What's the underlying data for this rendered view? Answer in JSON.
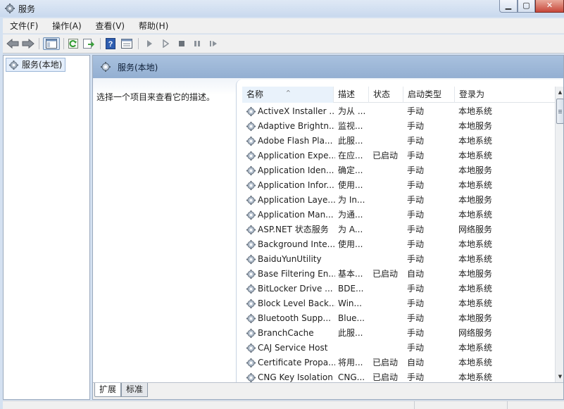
{
  "window": {
    "title": "服务",
    "app_icon": "gear-icon",
    "controls": [
      "minimize-icon",
      "maximize-icon",
      "close-icon"
    ]
  },
  "menu": [
    {
      "label": "文件(F)"
    },
    {
      "label": "操作(A)"
    },
    {
      "label": "查看(V)"
    },
    {
      "label": "帮助(H)"
    }
  ],
  "toolbar": {
    "buttons": [
      "back-arrow-icon",
      "forward-arrow-icon",
      "show-hide-tree-icon",
      "refresh-icon",
      "export-list-icon",
      "help-icon",
      "properties-icon",
      "start-service-icon",
      "start-service-params-icon",
      "stop-service-icon",
      "pause-service-icon",
      "restart-service-icon"
    ]
  },
  "tree": {
    "selected_label": "服务(本地)"
  },
  "main": {
    "header_title": "服务(本地)",
    "description_prompt": "选择一个项目来查看它的描述。",
    "columns": {
      "name": "名称",
      "description": "描述",
      "status": "状态",
      "startup_type": "启动类型",
      "log_on_as": "登录为"
    },
    "sort_indicator": "^",
    "services": [
      {
        "name": "ActiveX Installer ...",
        "description": "为从 ...",
        "status": "",
        "startup": "手动",
        "logon": "本地系统"
      },
      {
        "name": "Adaptive Brightn...",
        "description": "监视...",
        "status": "",
        "startup": "手动",
        "logon": "本地服务"
      },
      {
        "name": "Adobe Flash Pla...",
        "description": "此服...",
        "status": "",
        "startup": "手动",
        "logon": "本地系统"
      },
      {
        "name": "Application Expe...",
        "description": "在应...",
        "status": "已启动",
        "startup": "手动",
        "logon": "本地系统"
      },
      {
        "name": "Application Iden...",
        "description": "确定...",
        "status": "",
        "startup": "手动",
        "logon": "本地服务"
      },
      {
        "name": "Application Infor...",
        "description": "使用...",
        "status": "",
        "startup": "手动",
        "logon": "本地系统"
      },
      {
        "name": "Application Laye...",
        "description": "为 In...",
        "status": "",
        "startup": "手动",
        "logon": "本地服务"
      },
      {
        "name": "Application Man...",
        "description": "为通...",
        "status": "",
        "startup": "手动",
        "logon": "本地系统"
      },
      {
        "name": "ASP.NET 状态服务",
        "description": "为 A...",
        "status": "",
        "startup": "手动",
        "logon": "网络服务"
      },
      {
        "name": "Background Inte...",
        "description": "使用...",
        "status": "",
        "startup": "手动",
        "logon": "本地系统"
      },
      {
        "name": "BaiduYunUtility",
        "description": "",
        "status": "",
        "startup": "手动",
        "logon": "本地系统"
      },
      {
        "name": "Base Filtering En...",
        "description": "基本...",
        "status": "已启动",
        "startup": "自动",
        "logon": "本地服务"
      },
      {
        "name": "BitLocker Drive ...",
        "description": "BDE...",
        "status": "",
        "startup": "手动",
        "logon": "本地系统"
      },
      {
        "name": "Block Level Back...",
        "description": "Win...",
        "status": "",
        "startup": "手动",
        "logon": "本地系统"
      },
      {
        "name": "Bluetooth Supp...",
        "description": "Blue...",
        "status": "",
        "startup": "手动",
        "logon": "本地服务"
      },
      {
        "name": "BranchCache",
        "description": "此服...",
        "status": "",
        "startup": "手动",
        "logon": "网络服务"
      },
      {
        "name": "CAJ Service Host",
        "description": "",
        "status": "",
        "startup": "手动",
        "logon": "本地系统"
      },
      {
        "name": "Certificate Propa...",
        "description": "将用...",
        "status": "已启动",
        "startup": "自动",
        "logon": "本地系统"
      },
      {
        "name": "CNG Key Isolation",
        "description": "CNG...",
        "status": "已启动",
        "startup": "手动",
        "logon": "本地系统"
      }
    ]
  },
  "tabs": [
    {
      "label": "扩展"
    },
    {
      "label": "标准"
    }
  ]
}
